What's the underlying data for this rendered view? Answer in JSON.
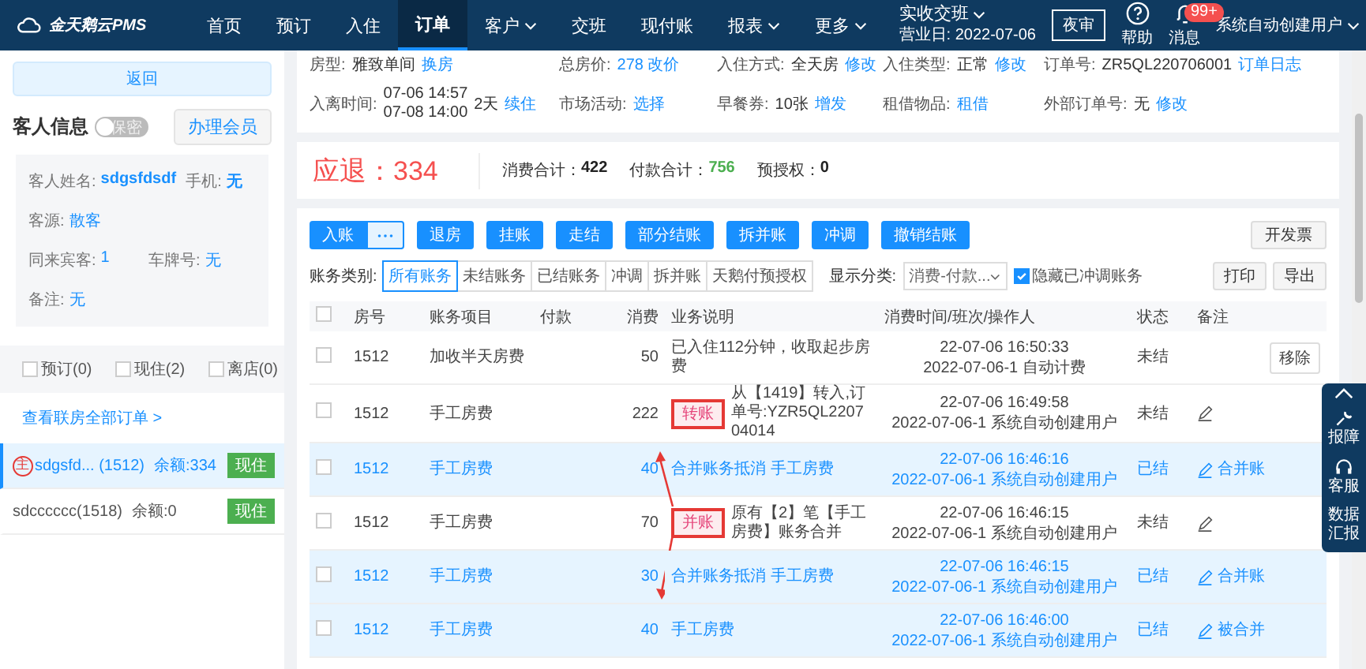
{
  "nav": {
    "logo": "金天鹅云PMS",
    "items": [
      {
        "label": "首页",
        "selected": false,
        "dropdown": false
      },
      {
        "label": "预订",
        "selected": false,
        "dropdown": false
      },
      {
        "label": "入住",
        "selected": false,
        "dropdown": false
      },
      {
        "label": "订单",
        "selected": true,
        "dropdown": false
      },
      {
        "label": "客户",
        "selected": false,
        "dropdown": true
      },
      {
        "label": "交班",
        "selected": false,
        "dropdown": false
      },
      {
        "label": "现付账",
        "selected": false,
        "dropdown": false
      },
      {
        "label": "报表",
        "selected": false,
        "dropdown": true
      },
      {
        "label": "更多",
        "selected": false,
        "dropdown": true
      }
    ],
    "shift": "实收交班",
    "business_day": "营业日: 2022-07-06",
    "audit_button": "夜审",
    "help": "帮助",
    "messages": "消息",
    "badge": "99+",
    "user": "系统自动创建用户"
  },
  "sidebar": {
    "back": "返回",
    "guest_title": "客人信息",
    "privacy_toggle": {
      "label": "保密",
      "on": false
    },
    "member_button": "办理会员",
    "fields": [
      [
        {
          "label": "客人姓名:",
          "value": "sdgsfdsdf",
          "bold": true
        },
        {
          "label": "手机:",
          "value": "无",
          "bold": true
        }
      ],
      [
        {
          "label": "客源:",
          "value": "散客",
          "bold": false
        }
      ],
      [
        {
          "label": "同来宾客:",
          "value": "1",
          "bold": false
        },
        {
          "label": "车牌号:",
          "value": "无",
          "bold": false
        }
      ],
      [
        {
          "label": "备注:",
          "value": "无",
          "bold": false
        }
      ]
    ],
    "filters": [
      {
        "label": "预订(0)",
        "checked": false
      },
      {
        "label": "现住(2)",
        "checked": false
      },
      {
        "label": "离店(0)",
        "checked": false
      }
    ],
    "all_orders_link": "查看联房全部订单 >",
    "rooms": [
      {
        "main_mark": "主",
        "name": "sdgsfd... (1512)",
        "balance": "余额:334",
        "status": "现住",
        "selected": true
      },
      {
        "name": "sdcccccc(1518)",
        "balance": "余额:0",
        "status": "现住",
        "selected": false
      }
    ]
  },
  "order_info": [
    [
      {
        "label": "房型:",
        "value": "雅致单间",
        "link": "换房"
      },
      {
        "label": "总房价:",
        "link": "278 改价"
      },
      {
        "label": "入住方式:",
        "value": "全天房",
        "link": "修改"
      },
      {
        "label": "入住类型:",
        "value": "正常",
        "link": "修改"
      },
      {
        "label": "订单号:",
        "value": "ZR5QL220706001",
        "link": "订单日志"
      }
    ],
    [
      {
        "label": "入离时间:",
        "lines": [
          "07-06 14:57",
          "07-08 14:00"
        ],
        "value": "2天",
        "link": "续住"
      },
      {
        "label": "市场活动:",
        "link": "选择"
      },
      {
        "label": "早餐券:",
        "value": "10张",
        "link": "增发"
      },
      {
        "label": "租借物品:",
        "link": "租借"
      },
      {
        "label": "外部订单号:",
        "value": "无",
        "link": "修改"
      }
    ]
  ],
  "summary": {
    "refund": "应退：334",
    "totals": [
      {
        "label": "消费合计：",
        "value": "422",
        "color": "#222222"
      },
      {
        "label": "付款合计：",
        "value": "756",
        "color": "#4caf50"
      },
      {
        "label": "预授权：",
        "value": "0",
        "color": "#222222"
      }
    ]
  },
  "toolbar": {
    "post_button": "入账",
    "actions": [
      "退房",
      "挂账",
      "走结",
      "部分结账",
      "拆并账",
      "冲调",
      "撤销结账"
    ],
    "invoice_button": "开发票"
  },
  "filter": {
    "category_label": "账务类别:",
    "categories": [
      {
        "label": "所有账务",
        "selected": true
      },
      {
        "label": "未结账务",
        "selected": false
      },
      {
        "label": "已结账务",
        "selected": false
      },
      {
        "label": "冲调",
        "selected": false
      },
      {
        "label": "拆并账",
        "selected": false
      },
      {
        "label": "天鹅付预授权",
        "selected": false
      }
    ],
    "display_label": "显示分类:",
    "display_select": "消费-付款...",
    "hide_adjusted": {
      "label": "隐藏已冲调账务",
      "checked": true
    },
    "print": "打印",
    "export": "导出"
  },
  "table": {
    "columns": [
      "房号",
      "账务项目",
      "付款",
      "消费",
      "业务说明",
      "消费时间/班次/操作人",
      "状态",
      "备注"
    ],
    "select_all": {
      "checked": false
    },
    "rows": [
      {
        "room": "1512",
        "item": "加收半天房费",
        "amount": "50",
        "description": "已入住112分钟，收取起步房费",
        "time": "22-07-06 16:50:33",
        "shift": "2022-07-06-1 自动计费",
        "status": "未结",
        "settled": false,
        "remark": {
          "kind": "button",
          "text": "移除"
        }
      },
      {
        "room": "1512",
        "item": "手工房费",
        "amount": "222",
        "tag": {
          "text": "转账",
          "boxed": true
        },
        "description": "从【1419】转入,订单号:YZR5QL220704014",
        "time": "22-07-06 16:49:58",
        "shift": "2022-07-06-1 系统自动创建用户",
        "status": "未结",
        "settled": false,
        "remark": {
          "kind": "edit"
        }
      },
      {
        "room": "1512",
        "item": "手工房费",
        "amount": "40",
        "description": "合并账务抵消 手工房费",
        "time": "22-07-06 16:46:16",
        "shift": "2022-07-06-1 系统自动创建用户",
        "status": "已结",
        "settled": true,
        "remark": {
          "kind": "edit",
          "text": "合并账"
        }
      },
      {
        "room": "1512",
        "item": "手工房费",
        "amount": "70",
        "tag": {
          "text": "并账",
          "boxed": true
        },
        "merge_arrows": true,
        "description": "原有【2】笔【手工房费】账务合并",
        "time": "22-07-06 16:46:15",
        "shift": "2022-07-06-1 系统自动创建用户",
        "status": "未结",
        "settled": false,
        "remark": {
          "kind": "edit"
        }
      },
      {
        "room": "1512",
        "item": "手工房费",
        "amount": "30",
        "description": "合并账务抵消 手工房费",
        "time": "22-07-06 16:46:15",
        "shift": "2022-07-06-1 系统自动创建用户",
        "status": "已结",
        "settled": true,
        "remark": {
          "kind": "edit",
          "text": "合并账"
        }
      },
      {
        "room": "1512",
        "item": "手工房费",
        "amount": "40",
        "description": "手工房费",
        "time": "22-07-06 16:46:00",
        "shift": "2022-07-06-1 系统自动创建用户",
        "status": "已结",
        "settled": true,
        "remark": {
          "kind": "edit",
          "text": "被合并"
        }
      }
    ]
  },
  "dock": [
    {
      "kind": "collapse"
    },
    {
      "kind": "wrench",
      "label": "报障"
    },
    {
      "kind": "headset",
      "label": "客服"
    },
    {
      "kind": "text",
      "label": "数据汇报"
    }
  ]
}
